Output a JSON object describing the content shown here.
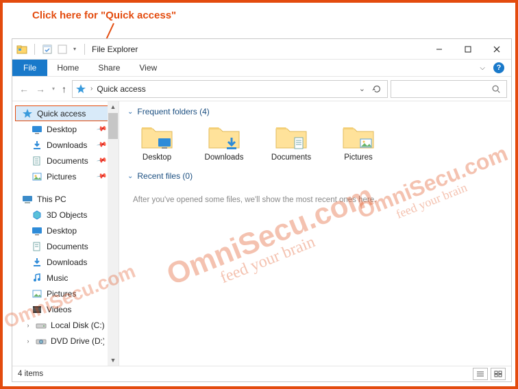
{
  "annotation": {
    "text": "Click here for \"Quick access\""
  },
  "titlebar": {
    "title": "File Explorer",
    "min": "–",
    "max": "▢",
    "close": "✕"
  },
  "ribbon": {
    "file": "File",
    "tabs": [
      "Home",
      "Share",
      "View"
    ]
  },
  "address": {
    "crumb": "Quick access"
  },
  "search": {
    "placeholder": ""
  },
  "sidebar": {
    "quick_access": {
      "label": "Quick access"
    },
    "qa_children": [
      {
        "label": "Desktop",
        "pinned": true
      },
      {
        "label": "Downloads",
        "pinned": true
      },
      {
        "label": "Documents",
        "pinned": true
      },
      {
        "label": "Pictures",
        "pinned": true
      }
    ],
    "this_pc": {
      "label": "This PC"
    },
    "pc_children": [
      {
        "label": "3D Objects"
      },
      {
        "label": "Desktop"
      },
      {
        "label": "Documents"
      },
      {
        "label": "Downloads"
      },
      {
        "label": "Music"
      },
      {
        "label": "Pictures"
      },
      {
        "label": "Videos"
      },
      {
        "label": "Local Disk (C:)"
      },
      {
        "label": "DVD Drive (D:) SSS"
      }
    ]
  },
  "content": {
    "frequent": {
      "title": "Frequent folders (4)"
    },
    "folders": [
      {
        "label": "Desktop"
      },
      {
        "label": "Downloads"
      },
      {
        "label": "Documents"
      },
      {
        "label": "Pictures"
      }
    ],
    "recent": {
      "title": "Recent files (0)",
      "empty": "After you've opened some files, we'll show the most recent ones here."
    }
  },
  "statusbar": {
    "items": "4 items"
  },
  "watermark": {
    "main": "OmniSecu.com",
    "sub": "feed your brain"
  }
}
